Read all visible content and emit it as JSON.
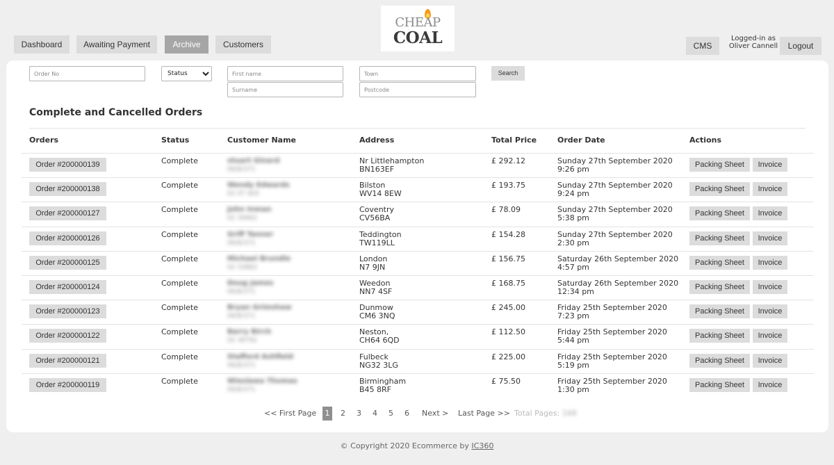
{
  "nav": {
    "dashboard": "Dashboard",
    "awaiting_payment": "Awaiting Payment",
    "archive": "Archive",
    "customers": "Customers",
    "cms": "CMS",
    "logged_in_line1": "Logged-in as",
    "logged_in_user": "Oliver Cannell",
    "logout": "Logout"
  },
  "logo": {
    "line1": "CHEAP",
    "line2": "COAL"
  },
  "filters": {
    "order_no_placeholder": "Order No",
    "status_selected": "Status",
    "first_name_placeholder": "First name",
    "surname_placeholder": "Surname",
    "town_placeholder": "Town",
    "postcode_placeholder": "Postcode",
    "search_label": "Search"
  },
  "section_title": "Complete and Cancelled Orders",
  "columns": {
    "orders": "Orders",
    "status": "Status",
    "customer_name": "Customer Name",
    "address": "Address",
    "total_price": "Total Price",
    "order_date": "Order Date",
    "actions": "Actions"
  },
  "actions": {
    "packing_sheet": "Packing Sheet",
    "invoice": "Invoice"
  },
  "orders": [
    {
      "order": "Order #200000139",
      "status": "Complete",
      "name": "stuart Ginard",
      "sub": "06/8/371",
      "town": "Nr Littlehampton",
      "postcode": "BN163EF",
      "price": "£ 292.12",
      "date": "Sunday 27th September 2020",
      "time": "9:26 pm"
    },
    {
      "order": "Order #200000138",
      "status": "Complete",
      "name": "Wendy Edwards",
      "sub": "02 07 405",
      "town": "Bilston",
      "postcode": "WV14 8EW",
      "price": "£ 193.75",
      "date": "Sunday 27th September 2020",
      "time": "9:24 pm"
    },
    {
      "order": "Order #200000127",
      "status": "Complete",
      "name": "John Inman",
      "sub": "02 39462",
      "town": "Coventry",
      "postcode": "CV56BA",
      "price": "£ 78.09",
      "date": "Sunday 27th September 2020",
      "time": "5:38 pm"
    },
    {
      "order": "Order #200000126",
      "status": "Complete",
      "name": "Griff Tanner",
      "sub": "06/8/371",
      "town": "Teddington",
      "postcode": "TW119LL",
      "price": "£ 154.28",
      "date": "Sunday 27th September 2020",
      "time": "2:30 pm"
    },
    {
      "order": "Order #200000125",
      "status": "Complete",
      "name": "Michael Brundle",
      "sub": "02 33862",
      "town": "London",
      "postcode": "N7 9JN",
      "price": "£ 156.75",
      "date": "Saturday 26th September 2020",
      "time": "4:57 pm"
    },
    {
      "order": "Order #200000124",
      "status": "Complete",
      "name": "Doug James",
      "sub": "06/8/371",
      "town": "Weedon",
      "postcode": "NN7 4SF",
      "price": "£ 168.75",
      "date": "Saturday 26th September 2020",
      "time": "12:34 pm"
    },
    {
      "order": "Order #200000123",
      "status": "Complete",
      "name": "Bryan Grimshaw",
      "sub": "06/8/371",
      "town": "Dunmow",
      "postcode": "CM6 3NQ",
      "price": "£ 245.00",
      "date": "Friday 25th September 2020",
      "time": "7:23 pm"
    },
    {
      "order": "Order #200000122",
      "status": "Complete",
      "name": "Barry Birch",
      "sub": "02 36792",
      "town": "Neston,",
      "postcode": "CH64 6QD",
      "price": "£ 112.50",
      "date": "Friday 25th September 2020",
      "time": "5:44 pm"
    },
    {
      "order": "Order #200000121",
      "status": "Complete",
      "name": "Stafford Ashfield",
      "sub": "06/8/371",
      "town": "Fulbeck",
      "postcode": "NG32 3LG",
      "price": "£ 225.00",
      "date": "Friday 25th September 2020",
      "time": "5:19 pm"
    },
    {
      "order": "Order #200000119",
      "status": "Complete",
      "name": "Wieslawa Thomas",
      "sub": "06/8/371",
      "town": "Birmingham",
      "postcode": "B45 8RF",
      "price": "£ 75.50",
      "date": "Friday 25th September 2020",
      "time": "1:30 pm"
    }
  ],
  "pagination": {
    "first": "<< First Page",
    "pages": [
      "1",
      "2",
      "3",
      "4",
      "5",
      "6"
    ],
    "current": "1",
    "next": "Next >",
    "last": "Last Page >>",
    "total_label": "Total Pages:",
    "total_value": "168"
  },
  "footer": {
    "text": "© Copyright 2020 Ecommerce by ",
    "link": "IC360"
  }
}
